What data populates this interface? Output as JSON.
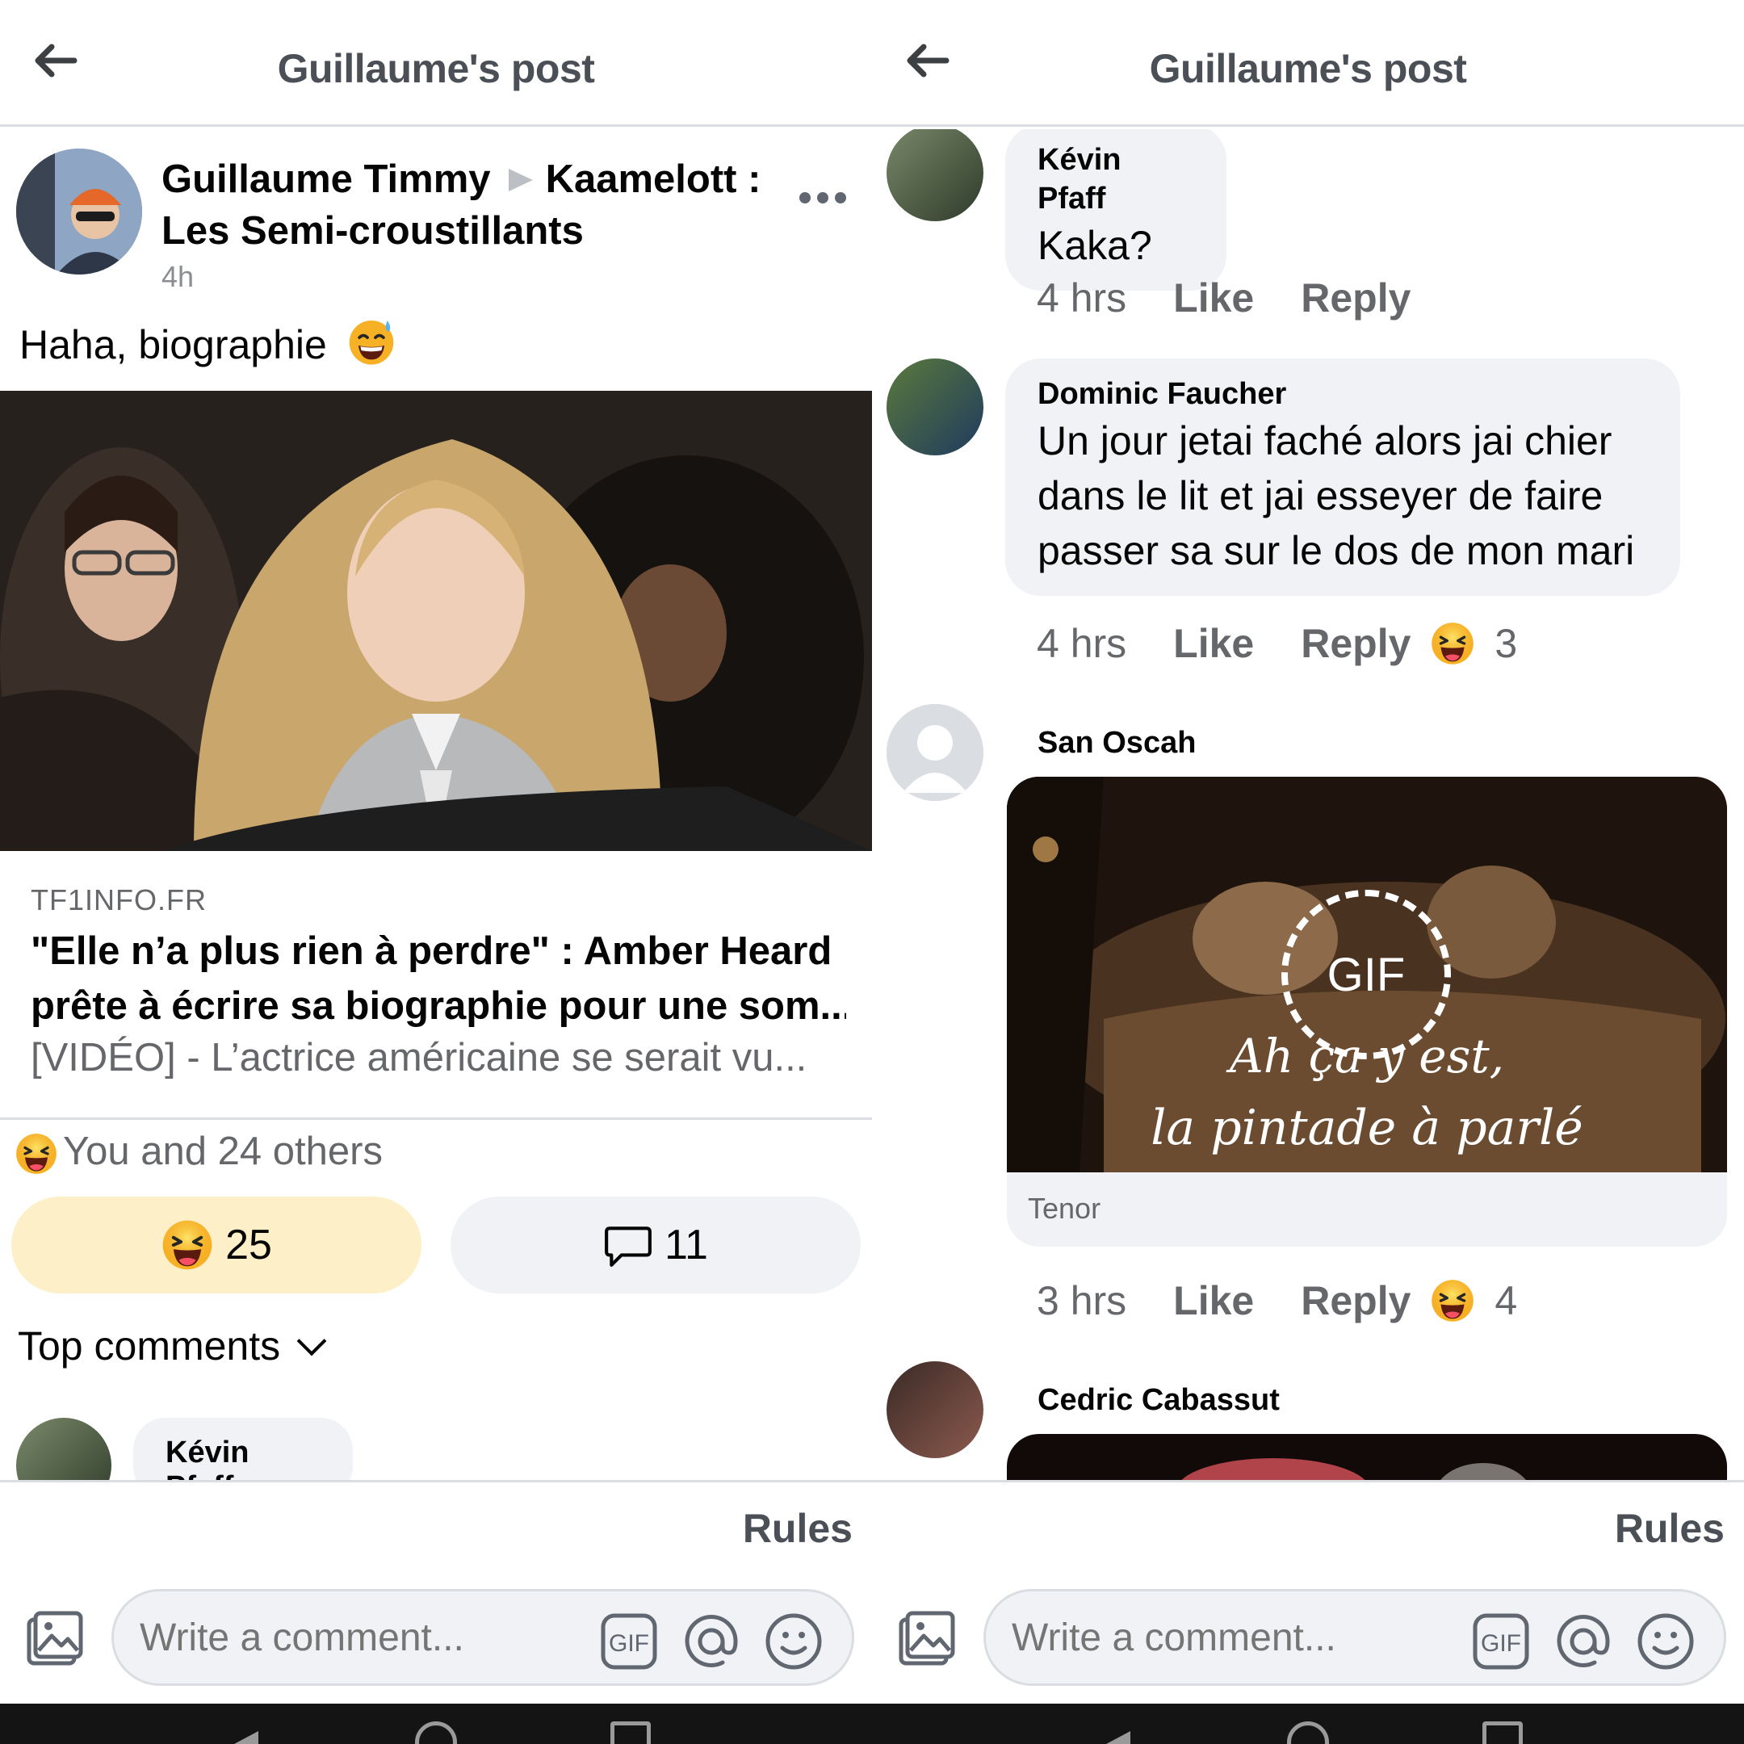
{
  "colors": {
    "accent_reaction_bg": "#fdefc7",
    "bubble_bg": "#f0f2f5",
    "text_primary": "#050505",
    "text_secondary": "#65676b"
  },
  "left": {
    "header": {
      "title": "Guillaume's post",
      "back_icon": "arrow-left-icon"
    },
    "post": {
      "author": "Guillaume Timmy",
      "group": "Kaamelott : Les Semi-croustillants",
      "time": "4h",
      "text": "Haha, biographie",
      "text_emoji": "grinning-sweat-emoji",
      "link": {
        "domain": "TF1INFO.FR",
        "title_line1": "\"Elle n’a plus rien à perdre\" : Amber Heard",
        "title_line2": "prête à écrire sa biographie pour une som...",
        "description": "[VIDÉO] - L’actrice américaine se serait vu..."
      },
      "reaction_summary": "You and 24 others",
      "reaction_count": "25",
      "comment_count": "11",
      "top_comments_label": "Top comments",
      "peek_comment_name": "Kévin Pfaff"
    },
    "footer": {
      "rules": "Rules",
      "comment_placeholder": "Write a comment..."
    }
  },
  "right": {
    "header": {
      "title": "Guillaume's post",
      "back_icon": "arrow-left-icon"
    },
    "comments": [
      {
        "name": "Kévin Pfaff",
        "text": "Kaka?",
        "time": "4 hrs",
        "like": "Like",
        "reply": "Reply"
      },
      {
        "name": "Dominic Faucher",
        "text_lines": [
          "Un jour jetai faché alors jai chier",
          "dans le lit et jai esseyer de faire",
          "passer sa sur le dos de mon mari"
        ],
        "time": "4 hrs",
        "like": "Like",
        "reply": "Reply",
        "reactions": "3"
      },
      {
        "name": "San Oscah",
        "gif_badge": "GIF",
        "gif_caption_1": "Ah ça y est,",
        "gif_caption_2": "la pintade à parlé",
        "gif_source": "Tenor",
        "time": "3 hrs",
        "like": "Like",
        "reply": "Reply",
        "reactions": "4"
      },
      {
        "name": "Cedric Cabassut"
      }
    ],
    "footer": {
      "rules": "Rules",
      "comment_placeholder": "Write a comment..."
    }
  }
}
